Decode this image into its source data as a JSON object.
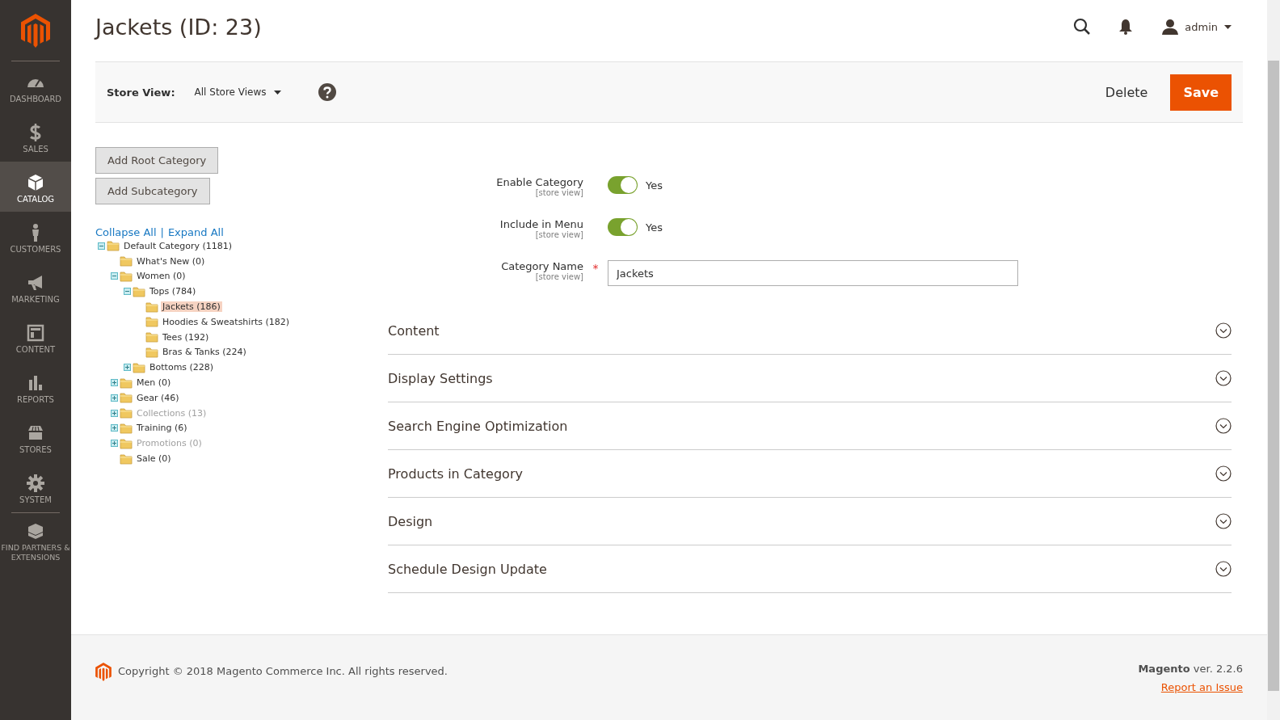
{
  "sidebar": {
    "items": [
      {
        "label": "DASHBOARD",
        "selected": false
      },
      {
        "label": "SALES",
        "selected": false
      },
      {
        "label": "CATALOG",
        "selected": true
      },
      {
        "label": "CUSTOMERS",
        "selected": false
      },
      {
        "label": "MARKETING",
        "selected": false
      },
      {
        "label": "CONTENT",
        "selected": false
      },
      {
        "label": "REPORTS",
        "selected": false
      },
      {
        "label": "STORES",
        "selected": false
      },
      {
        "label": "SYSTEM",
        "selected": false
      },
      {
        "label": "FIND PARTNERS & EXTENSIONS",
        "selected": false
      }
    ]
  },
  "header": {
    "title": "Jackets (ID: 23)",
    "user": "admin"
  },
  "actions": {
    "store_view_label": "Store View:",
    "store_view": "All Store Views",
    "buttons": [
      {
        "label": "Delete",
        "kind": "plain"
      },
      {
        "label": "Save",
        "kind": "primary"
      }
    ]
  },
  "tree_buttons": [
    "Add Root Category",
    "Add Subcategory"
  ],
  "tree_links": {
    "collapse": "Collapse All",
    "separator": "|",
    "expand": "Expand All"
  },
  "tree": [
    {
      "label": "Default Category (1181)",
      "expandable": true,
      "expanded": true,
      "disabled": false,
      "selected": false,
      "children": [
        {
          "label": "What's New (0)",
          "expandable": false,
          "disabled": false,
          "selected": false
        },
        {
          "label": "Women (0)",
          "expandable": true,
          "expanded": true,
          "disabled": false,
          "selected": false,
          "children": [
            {
              "label": "Tops (784)",
              "expandable": true,
              "expanded": true,
              "disabled": false,
              "selected": false,
              "children": [
                {
                  "label": "Jackets (186)",
                  "expandable": false,
                  "disabled": false,
                  "selected": true
                },
                {
                  "label": "Hoodies & Sweatshirts (182)",
                  "expandable": false,
                  "disabled": false,
                  "selected": false
                },
                {
                  "label": "Tees (192)",
                  "expandable": false,
                  "disabled": false,
                  "selected": false
                },
                {
                  "label": "Bras & Tanks (224)",
                  "expandable": false,
                  "disabled": false,
                  "selected": false
                }
              ]
            },
            {
              "label": "Bottoms (228)",
              "expandable": true,
              "expanded": false,
              "disabled": false,
              "selected": false
            }
          ]
        },
        {
          "label": "Men (0)",
          "expandable": true,
          "expanded": false,
          "disabled": false,
          "selected": false
        },
        {
          "label": "Gear (46)",
          "expandable": true,
          "expanded": false,
          "disabled": false,
          "selected": false
        },
        {
          "label": "Collections (13)",
          "expandable": true,
          "expanded": false,
          "disabled": true,
          "selected": false
        },
        {
          "label": "Training (6)",
          "expandable": true,
          "expanded": false,
          "disabled": false,
          "selected": false
        },
        {
          "label": "Promotions (0)",
          "expandable": true,
          "expanded": false,
          "disabled": true,
          "selected": false
        },
        {
          "label": "Sale (0)",
          "expandable": false,
          "disabled": false,
          "selected": false
        }
      ]
    }
  ],
  "form": {
    "fields": [
      {
        "kind": "toggle",
        "label": "Enable Category",
        "scope": "[store view]",
        "on": true,
        "value": "Yes",
        "required": false
      },
      {
        "kind": "toggle",
        "label": "Include in Menu",
        "scope": "[store view]",
        "on": true,
        "value": "Yes",
        "required": false
      },
      {
        "kind": "text",
        "label": "Category Name",
        "scope": "[store view]",
        "value": "Jackets",
        "required": true,
        "required_mark": "*"
      }
    ]
  },
  "sections": [
    {
      "title": "Content",
      "expanded": false
    },
    {
      "title": "Display Settings",
      "expanded": false
    },
    {
      "title": "Search Engine Optimization",
      "expanded": false
    },
    {
      "title": "Products in Category",
      "expanded": false
    },
    {
      "title": "Design",
      "expanded": false
    },
    {
      "title": "Schedule Design Update",
      "expanded": false
    }
  ],
  "footer": {
    "copyright": "Copyright © 2018 Magento Commerce Inc. All rights reserved.",
    "version": "**Magento** ver. 2.2.6",
    "report_link": "Report an Issue"
  }
}
